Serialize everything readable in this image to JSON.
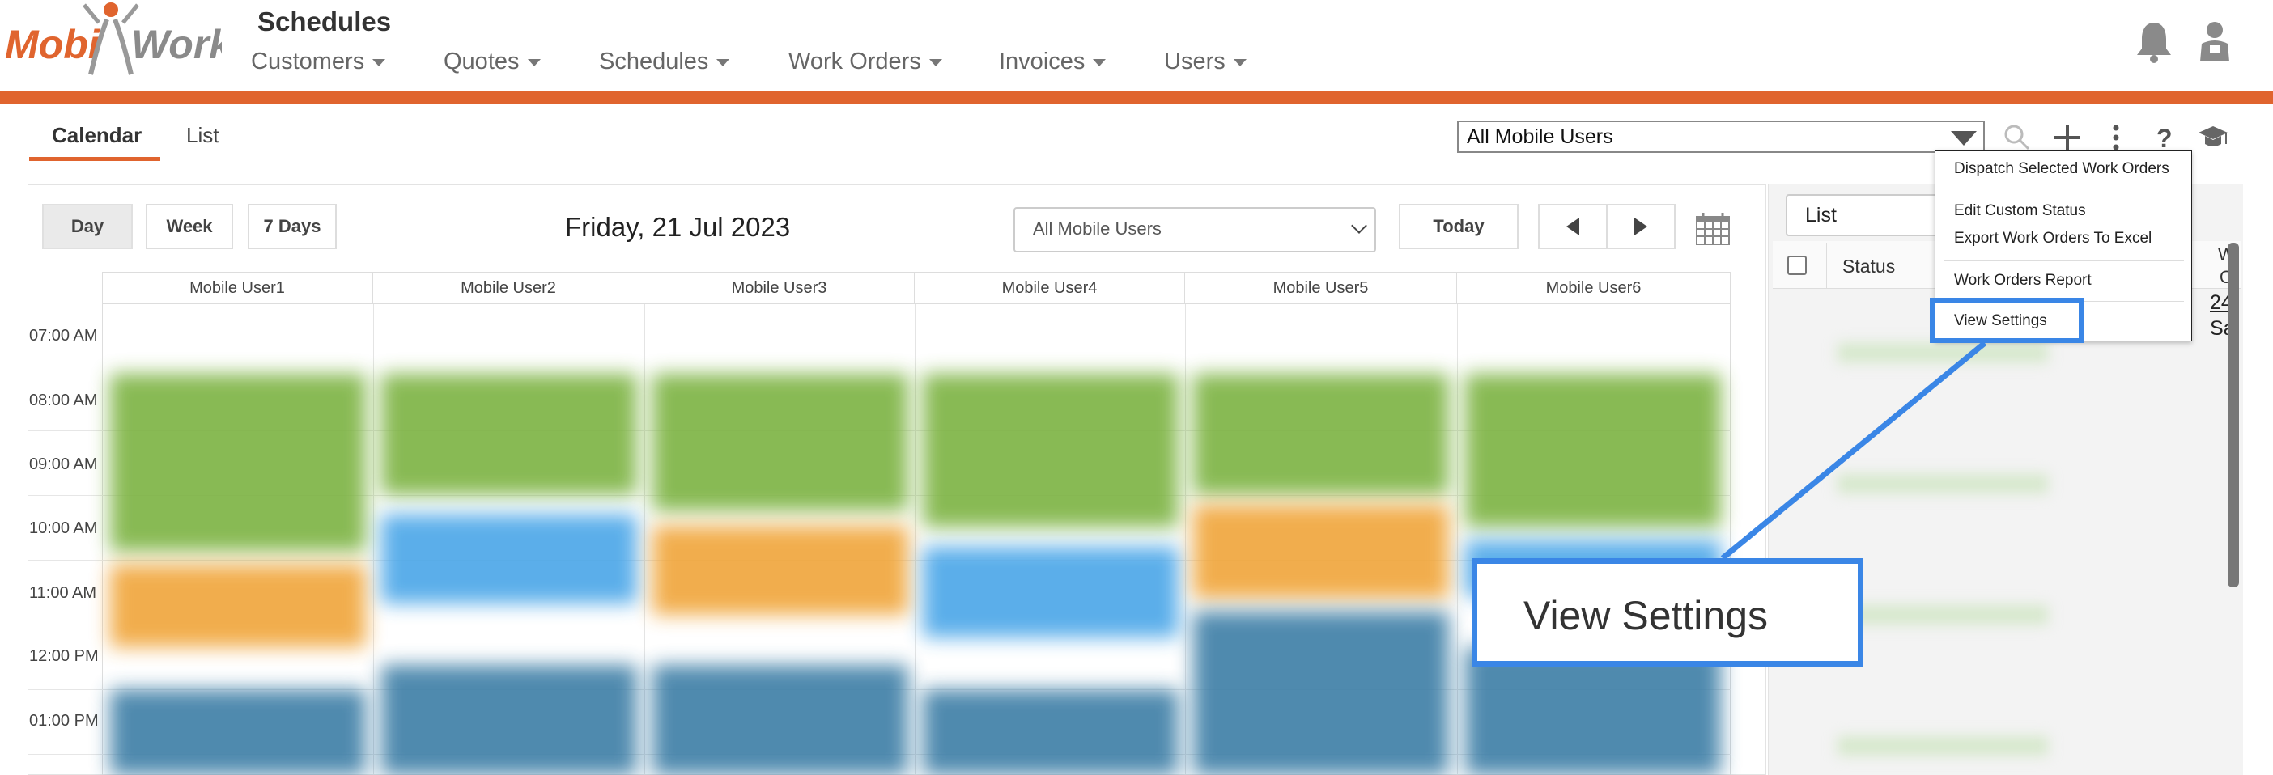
{
  "header": {
    "logo_left": "Mobi",
    "logo_right": "Work",
    "page_title": "Schedules",
    "nav": [
      {
        "label": "Customers"
      },
      {
        "label": "Quotes"
      },
      {
        "label": "Schedules"
      },
      {
        "label": "Work Orders"
      },
      {
        "label": "Invoices"
      },
      {
        "label": "Users"
      }
    ],
    "icons": [
      "bell-icon",
      "user-icon"
    ],
    "accent_color": "#e0642e"
  },
  "tabs": [
    {
      "label": "Calendar",
      "active": true
    },
    {
      "label": "List",
      "active": false
    }
  ],
  "toolbar": {
    "user_filter": "All Mobile Users",
    "icons": [
      "search-icon",
      "plus-icon",
      "more-vertical-icon",
      "help-icon",
      "graduation-cap-icon"
    ]
  },
  "calendar": {
    "view_buttons": [
      "Day",
      "Week",
      "7 Days"
    ],
    "active_view": "Day",
    "date": "Friday, 21 Jul 2023",
    "user_filter": "All Mobile Users",
    "today_label": "Today",
    "columns": [
      "Mobile User1",
      "Mobile User2",
      "Mobile User3",
      "Mobile User4",
      "Mobile User5",
      "Mobile User6"
    ],
    "times": [
      "07:00 AM",
      "08:00 AM",
      "09:00 AM",
      "10:00 AM",
      "11:00 AM",
      "12:00 PM",
      "01:00 PM"
    ]
  },
  "right_panel": {
    "view_select": "List",
    "status_header": "Status",
    "partial_header_line1": "W",
    "partial_header_line2": "O",
    "partial_link": "24",
    "partial_text": "Sa"
  },
  "dropdown_menu": {
    "items": [
      "Dispatch Selected Work Orders",
      "Edit Custom Status",
      "Export Work Orders To Excel",
      "Work Orders Report",
      "View Settings"
    ],
    "highlighted": "View Settings"
  },
  "callout": {
    "text": "View Settings",
    "color": "#3a86e6"
  }
}
